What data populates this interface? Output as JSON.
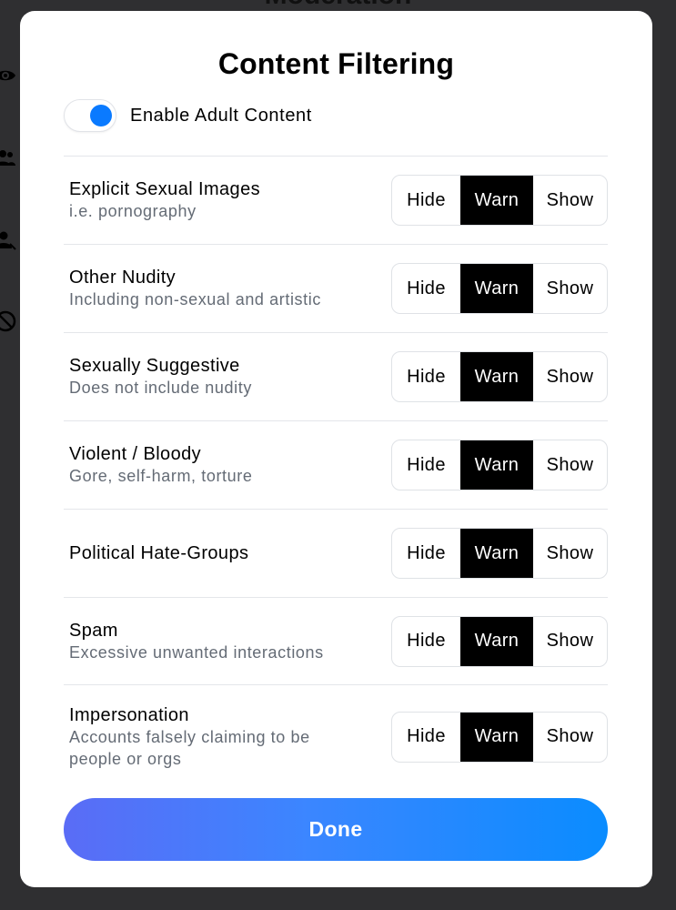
{
  "background": {
    "title": "Moderation",
    "icons": [
      "eye-icon",
      "users-icon",
      "user-block-icon",
      "block-icon"
    ]
  },
  "modal": {
    "title": "Content Filtering",
    "toggle": {
      "label": "Enable Adult Content",
      "enabled": true,
      "color": "#0a7aff"
    },
    "options": [
      "Hide",
      "Warn",
      "Show"
    ],
    "rows": [
      {
        "title": "Explicit Sexual Images",
        "subtitle": "i.e. pornography",
        "selected": "Warn"
      },
      {
        "title": "Other Nudity",
        "subtitle": "Including non-sexual and artistic",
        "selected": "Warn"
      },
      {
        "title": "Sexually Suggestive",
        "subtitle": "Does not include nudity",
        "selected": "Warn"
      },
      {
        "title": "Violent / Bloody",
        "subtitle": "Gore, self-harm, torture",
        "selected": "Warn"
      },
      {
        "title": "Political Hate-Groups",
        "subtitle": "",
        "selected": "Warn"
      },
      {
        "title": "Spam",
        "subtitle": "Excessive unwanted interactions",
        "selected": "Warn"
      },
      {
        "title": "Impersonation",
        "subtitle": "Accounts falsely claiming to be people or orgs",
        "selected": "Warn"
      }
    ],
    "done_label": "Done"
  },
  "colors": {
    "selected": "#000000",
    "accent_start": "#5a6cf6",
    "accent_end": "#0a8cff"
  }
}
